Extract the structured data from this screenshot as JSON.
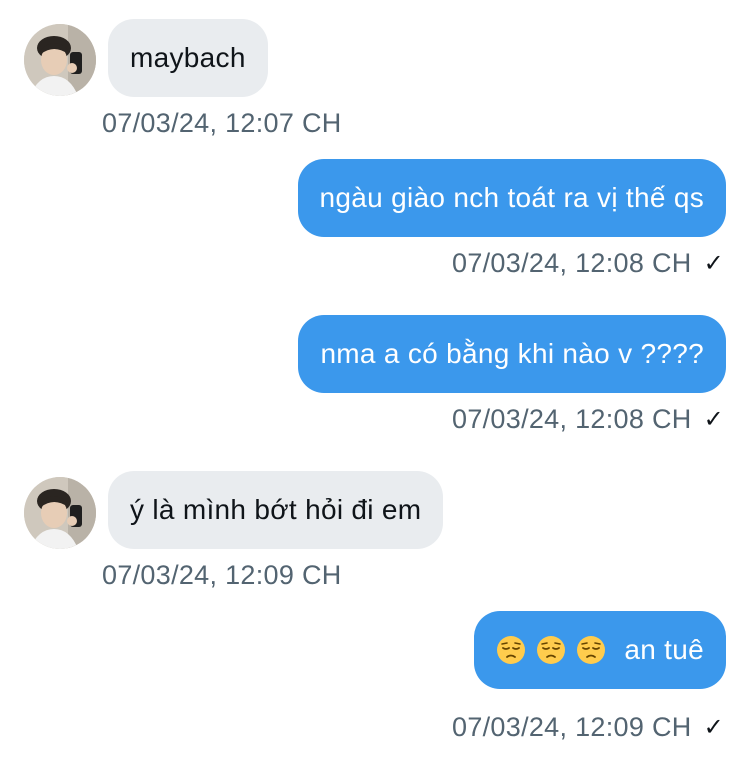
{
  "messages": [
    {
      "direction": "in",
      "text": "maybach",
      "time": "07/03/24, 12:07 CH"
    },
    {
      "direction": "out",
      "text": "ngàu giào nch toát ra vị thế qs",
      "time": "07/03/24, 12:08 CH",
      "status": "✓"
    },
    {
      "direction": "out",
      "text": "nma a có bằng khi nào v ????",
      "time": "07/03/24, 12:08 CH",
      "status": "✓"
    },
    {
      "direction": "in",
      "text": "ý là mình bớt hỏi đi em",
      "time": "07/03/24, 12:09 CH"
    },
    {
      "direction": "out",
      "emojis": [
        "pensive-face",
        "pensive-face",
        "pensive-face"
      ],
      "text": "an tuê",
      "time": "07/03/24, 12:09 CH",
      "status": "✓"
    }
  ],
  "colors": {
    "incoming_bubble": "#e9ecef",
    "outgoing_bubble": "#3b98ec",
    "timestamp": "#536471"
  }
}
